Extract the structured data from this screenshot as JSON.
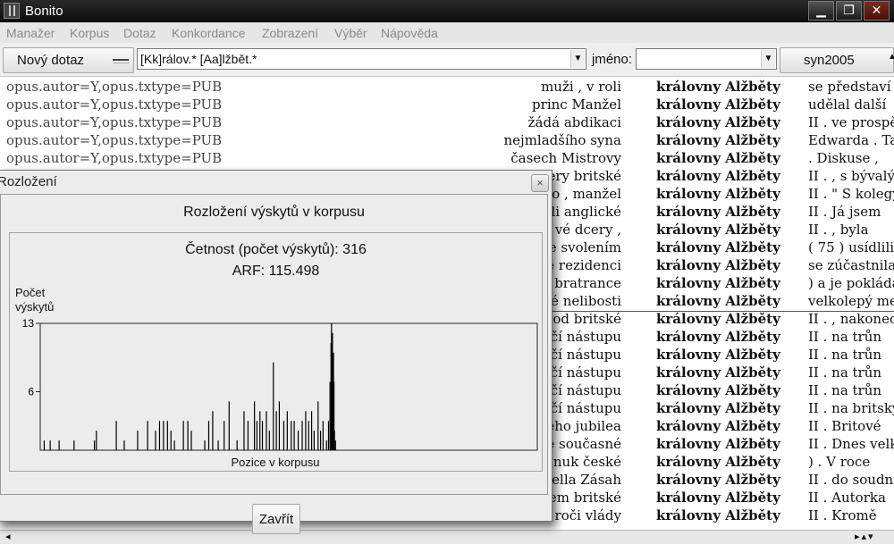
{
  "window": {
    "title": "Bonito"
  },
  "menu": [
    "Manažer",
    "Korpus",
    "Dotaz",
    "Konkordance",
    "Zobrazení",
    "Výběr",
    "Nápověda"
  ],
  "toolbar": {
    "new_query": "Nový dotaz",
    "query": "[Kk]rálov.* [Aa]lžbět.*",
    "name_label": "jméno:",
    "name_value": "",
    "corpus": "syn2005"
  },
  "concordance": {
    "rows": [
      {
        "meta": "opus.autor=Y,opus.txtype=PUB",
        "left": "muži , v roli",
        "kwic": "královny Alžběty",
        "right": "se představí"
      },
      {
        "meta": "opus.autor=Y,opus.txtype=PUB",
        "left": "princ Manžel",
        "kwic": "královny Alžběty",
        "right": "udělal další"
      },
      {
        "meta": "opus.autor=Y,opus.txtype=PUB",
        "left": "žádá abdikaci",
        "kwic": "královny Alžběty",
        "right": "II . ve prospě"
      },
      {
        "meta": "opus.autor=Y,opus.txtype=PUB",
        "left": "nejmladšího syna",
        "kwic": "královny Alžběty",
        "right": "Edwarda . Ta"
      },
      {
        "meta": "opus.autor=Y,opus.txtype=PUB",
        "left": "časech Mistrovy",
        "kwic": "královny Alžběty",
        "right": ". Diskuse ,"
      },
      {
        "meta": "",
        "left": "ery britské",
        "kwic": "královny Alžběty",
        "right": "II . , s bývalý"
      },
      {
        "meta": "",
        "left": "o , manžel",
        "kwic": "královny Alžběty",
        "right": "II . \" S kolegy"
      },
      {
        "meta": "",
        "left": "li anglické",
        "kwic": "královny Alžběty",
        "right": "II . Já jsem"
      },
      {
        "meta": "",
        "left": "vé dcery ,",
        "kwic": "královny Alžběty",
        "right": "II . , byla"
      },
      {
        "meta": "",
        "left": "e svolením",
        "kwic": "královny Alžběty",
        "right": "( 75 ) usídlili"
      },
      {
        "meta": "",
        "left": "e rezidenci",
        "kwic": "královny Alžběty",
        "right": "se zúčastnila"
      },
      {
        "meta": "",
        "left": "bratrance",
        "kwic": "královny Alžběty",
        "right": ") a je pokládá"
      },
      {
        "meta": "",
        "left": "ké nelibosti",
        "kwic": "královny Alžběty",
        "right": "velkolepý me"
      },
      {
        "meta": "",
        "left": "od britské",
        "kwic": "královny Alžběty",
        "right": "II . , nakonec"
      },
      {
        "meta": "",
        "left": "čí nástupu",
        "kwic": "královny Alžběty",
        "right": "II . na trůn"
      },
      {
        "meta": "",
        "left": "čí nástupu",
        "kwic": "královny Alžběty",
        "right": "II . na trůn"
      },
      {
        "meta": "",
        "left": "čí nástupu",
        "kwic": "královny Alžběty",
        "right": "II . na trůn"
      },
      {
        "meta": "",
        "left": "čí nástupu",
        "kwic": "královny Alžběty",
        "right": "II . na trůn"
      },
      {
        "meta": "",
        "left": "čí nástupu",
        "kwic": "královny Alžběty",
        "right": "II . na britský"
      },
      {
        "meta": "",
        "left": "ého jubilea",
        "kwic": "královny Alžběty",
        "right": "II . Britové"
      },
      {
        "meta": "",
        "left": "e současné",
        "kwic": "královny Alžběty",
        "right": "II . Dnes velk"
      },
      {
        "meta": "",
        "left": "nuk české",
        "kwic": "královny Alžběty",
        "right": ") . V roce"
      },
      {
        "meta": "",
        "left": "ella Zásah",
        "kwic": "královny Alžběty",
        "right": "II . do soudní"
      },
      {
        "meta": "",
        "left": "em britské",
        "kwic": "královny Alžběty",
        "right": "II . Autorka"
      },
      {
        "meta": "",
        "left": "roči vlády",
        "kwic": "královny Alžběty",
        "right": "II . Kromě"
      }
    ]
  },
  "dialog": {
    "title": "Rozložení",
    "close_icon": "×",
    "heading": "Rozložení výskytů v korpusu",
    "frequency_label": "Četnost (počet výskytů): 316",
    "arf_label": "ARF: 115.498",
    "close_button": "Zavřít"
  },
  "chart_data": {
    "type": "bar",
    "title": "",
    "xlabel": "Pozice v korpusu",
    "ylabel": "Počet výskytů",
    "ylim": [
      0,
      13
    ],
    "yticks": [
      6,
      13
    ],
    "x_range": [
      0,
      1000
    ],
    "bar_color": "#000000",
    "series": [
      {
        "positions": [
          8,
          20,
          38,
          68,
          109,
          113,
          153,
          169,
          196,
          216,
          232,
          240,
          248,
          256,
          263,
          270,
          288,
          297,
          304,
          331,
          339,
          347,
          358,
          370,
          380,
          396,
          410,
          418,
          431,
          436,
          442,
          447,
          455,
          461,
          469,
          475,
          481,
          490,
          497,
          505,
          511,
          519,
          527,
          534,
          540,
          546,
          551,
          559,
          564,
          569,
          576,
          580,
          583,
          585,
          586,
          587,
          588,
          589,
          590,
          591,
          592,
          594
        ],
        "values": [
          1,
          1,
          1,
          1,
          1,
          2,
          3,
          1,
          2,
          3,
          2,
          3,
          3,
          3,
          2,
          1,
          3,
          3,
          2,
          1,
          3,
          4,
          1,
          3,
          5,
          1,
          4,
          3,
          5,
          3,
          4,
          3,
          4,
          2,
          9,
          4,
          5,
          3,
          4,
          3,
          3,
          2,
          3,
          4,
          3,
          4,
          2,
          5,
          2,
          3,
          1,
          3,
          7,
          11,
          13,
          9,
          12,
          8,
          10,
          7,
          2,
          1
        ]
      }
    ]
  }
}
